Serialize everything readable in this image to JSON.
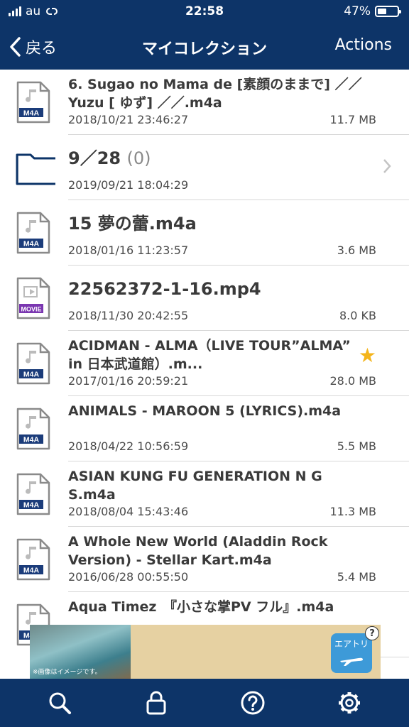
{
  "status_bar": {
    "carrier": "au",
    "time": "22:58",
    "battery": "47%",
    "battery_level": 0.47
  },
  "nav": {
    "back_label": "戻る",
    "title": "マイコレクション",
    "actions_label": "Actions"
  },
  "colors": {
    "bar": "#0d3468",
    "m4a_badge": "#1b3c7a",
    "movie_badge": "#7a36b0",
    "star": "#f4b41a"
  },
  "files": [
    {
      "type": "m4a",
      "badge": "M4A",
      "name": "6.  Sugao no Mama de [素顔のままで]  ／／ Yuzu [ ゆず] ／／.m4a",
      "date": "2018/10/21 23:46:27",
      "size": "11.7 MB"
    },
    {
      "type": "folder",
      "name": "9／28",
      "count": "(0)",
      "date": "2019/09/21 18:04:29"
    },
    {
      "type": "m4a",
      "badge": "M4A",
      "name": "15 夢の蕾.m4a",
      "date": "2018/01/16 11:23:57",
      "size": "3.6 MB"
    },
    {
      "type": "movie",
      "badge": "MOVIE",
      "name": "22562372-1-16.mp4",
      "date": "2018/11/30 20:42:55",
      "size": "8.0 KB"
    },
    {
      "type": "m4a",
      "badge": "M4A",
      "name": "ACIDMAN - ALMA（LIVE TOUR”ALMA” in 日本武道館）.m...",
      "date": "2017/01/16 20:59:21",
      "size": "28.0 MB",
      "starred": true
    },
    {
      "type": "m4a",
      "badge": "M4A",
      "name": "ANIMALS - MAROON 5 (LYRICS).m4a",
      "date": "2018/04/22 10:56:59",
      "size": "5.5 MB"
    },
    {
      "type": "m4a",
      "badge": "M4A",
      "name": "ASIAN KUNG FU GENERATION N G S.m4a",
      "date": "2018/08/04 15:43:46",
      "size": "11.3 MB"
    },
    {
      "type": "m4a",
      "badge": "M4A",
      "name": "A Whole New World (Aladdin Rock Version) - Stellar Kart.m4a",
      "date": "2016/06/28 00:55:50",
      "size": "5.4 MB"
    },
    {
      "type": "m4a",
      "badge": "M4A",
      "name": "Aqua Timez　『小さな掌PV フル』.m4a",
      "date": "",
      "size": ""
    }
  ],
  "ad": {
    "brand": "エアトリ",
    "caption": "※画像はイメージです。",
    "help": "?"
  },
  "tabs": [
    {
      "icon": "search-icon"
    },
    {
      "icon": "lock-icon"
    },
    {
      "icon": "help-icon"
    },
    {
      "icon": "gear-icon"
    }
  ]
}
